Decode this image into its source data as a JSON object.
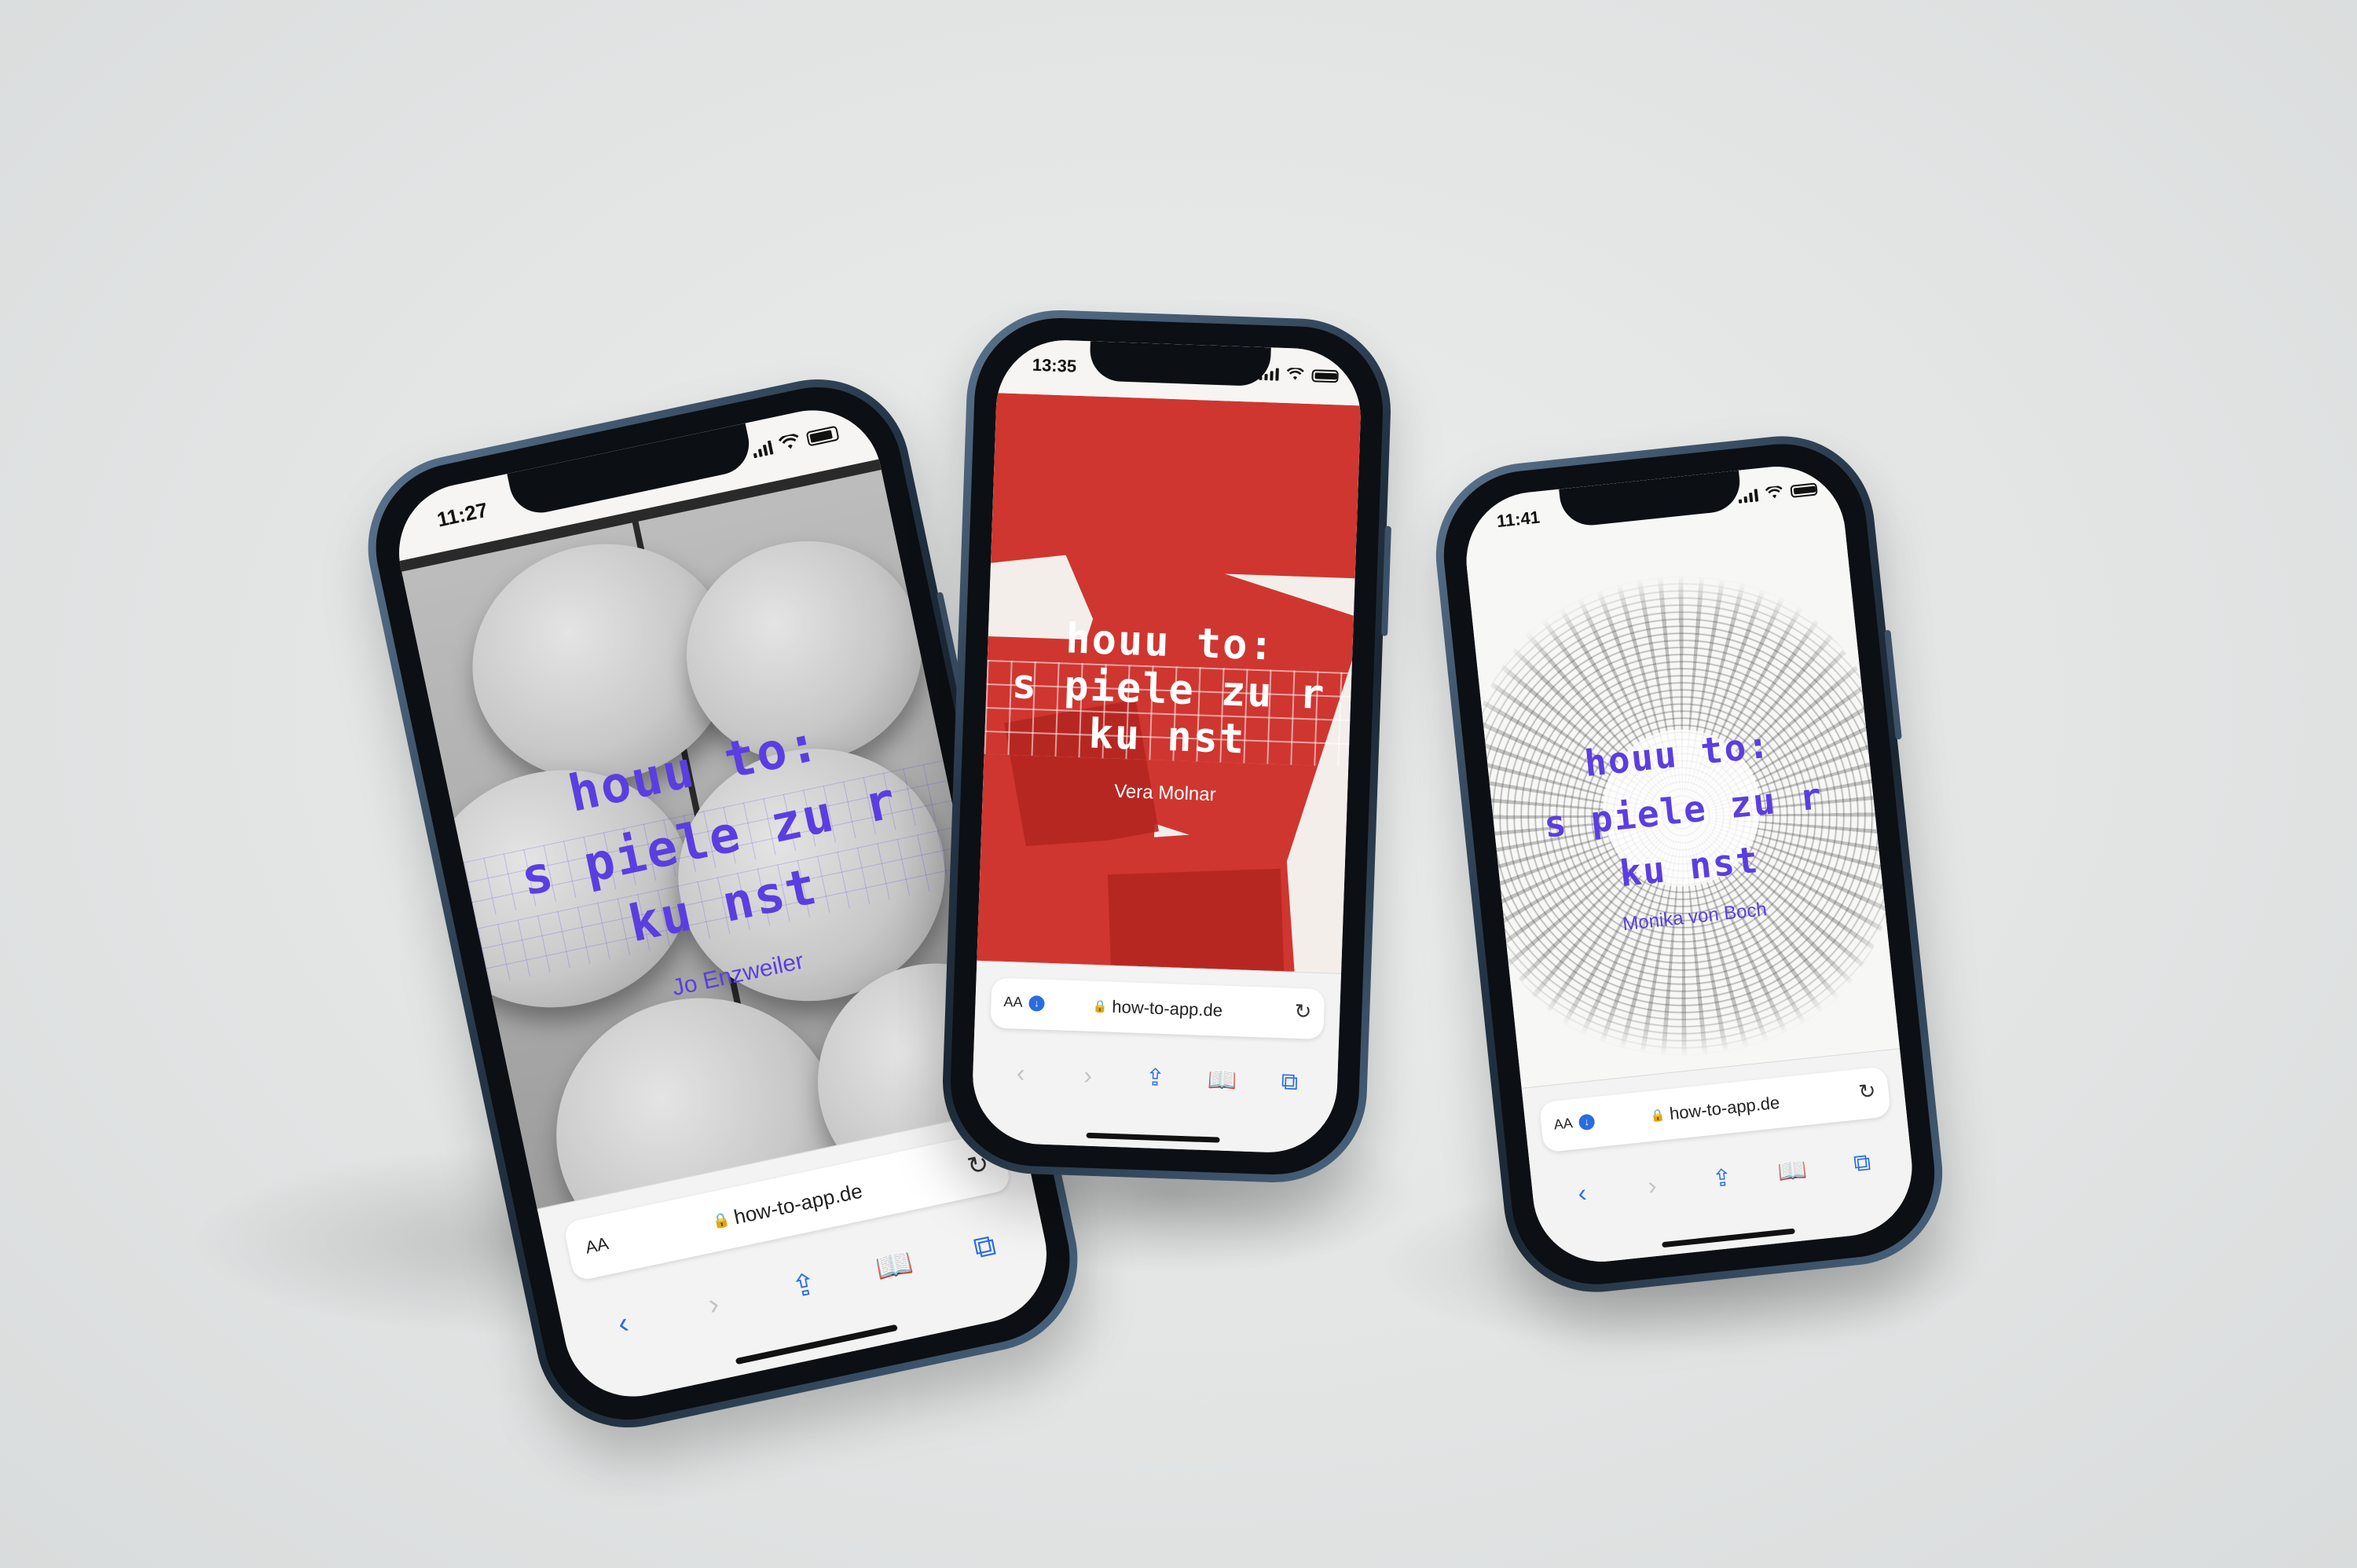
{
  "phones": [
    {
      "id": "left",
      "time": "11:27",
      "title_lines": [
        "houu to:",
        "s piele zu r",
        "ku nst"
      ],
      "artist": "Jo Enzweiler",
      "url": "how-to-app.de",
      "aa": "AA",
      "artwork": "grey-discs",
      "accent": "#5b3ee0"
    },
    {
      "id": "center",
      "time": "13:35",
      "title_lines": [
        "houu to:",
        "s piele zu r",
        "ku nst"
      ],
      "artist": "Vera Molnar",
      "url": "how-to-app.de",
      "aa": "AA",
      "artwork": "red-squares",
      "accent": "#ffffff",
      "artwork_color": "#cf3630"
    },
    {
      "id": "right",
      "time": "11:41",
      "title_lines": [
        "houu to:",
        "s piele zu r",
        "ku nst"
      ],
      "artist": "Monika von Boch",
      "url": "how-to-app.de",
      "aa": "AA",
      "artwork": "dot-swirl",
      "accent": "#5b3ee0"
    }
  ],
  "icons": {
    "back": "chevron-left-icon",
    "forward": "chevron-right-icon",
    "share": "share-icon",
    "bookmarks": "book-icon",
    "tabs": "tabs-icon",
    "reload": "reload-icon",
    "lock": "lock-icon",
    "download": "download-icon"
  }
}
